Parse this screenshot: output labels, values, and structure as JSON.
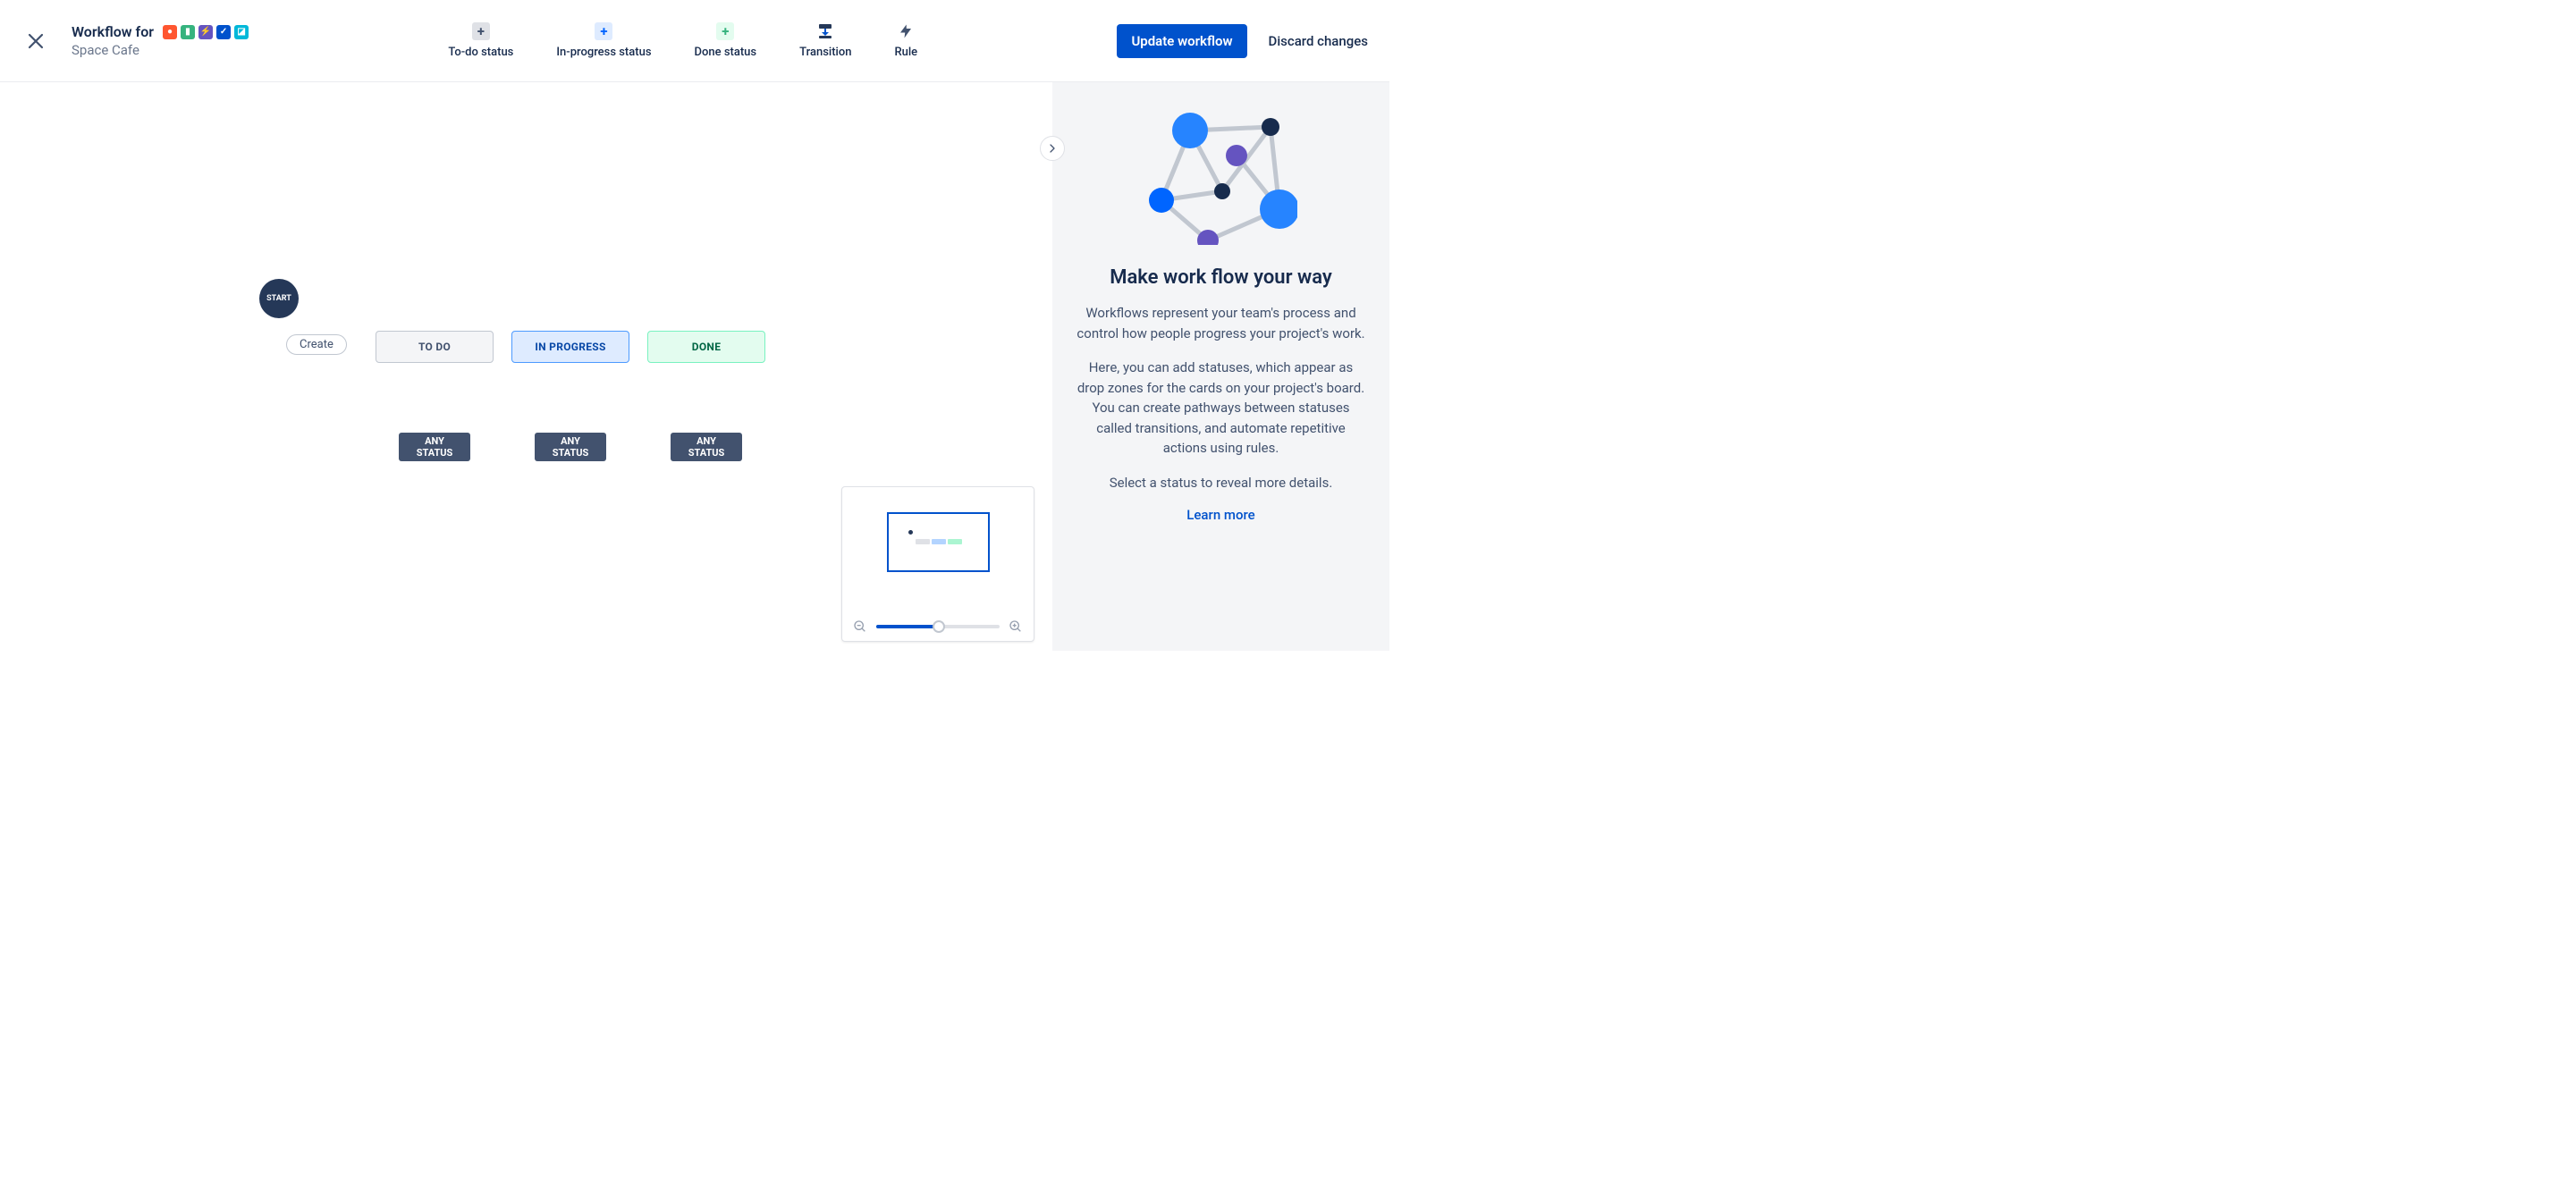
{
  "header": {
    "title_prefix": "Workflow for",
    "subtitle": "Space Cafe"
  },
  "toolbar": {
    "todo_label": "To-do status",
    "inprogress_label": "In-progress status",
    "done_label": "Done status",
    "transition_label": "Transition",
    "rule_label": "Rule"
  },
  "actions": {
    "update_label": "Update workflow",
    "discard_label": "Discard changes"
  },
  "diagram": {
    "start_label": "START",
    "create_label": "Create",
    "statuses": {
      "todo": "TO DO",
      "in_progress": "IN PROGRESS",
      "done": "DONE"
    },
    "any_status_label_1": "ANY STATUS",
    "any_status_label_2": "ANY STATUS",
    "any_status_label_3": "ANY STATUS"
  },
  "side": {
    "title": "Make work flow your way",
    "p1": "Workflows represent your team's process and control how people progress your project's work.",
    "p2": "Here, you can add statuses, which appear as drop zones for the cards on your project's board. You can create pathways between statuses called transitions, and automate repetitive actions using rules.",
    "p3": "Select a status to reveal more details.",
    "learn_more": "Learn more"
  }
}
